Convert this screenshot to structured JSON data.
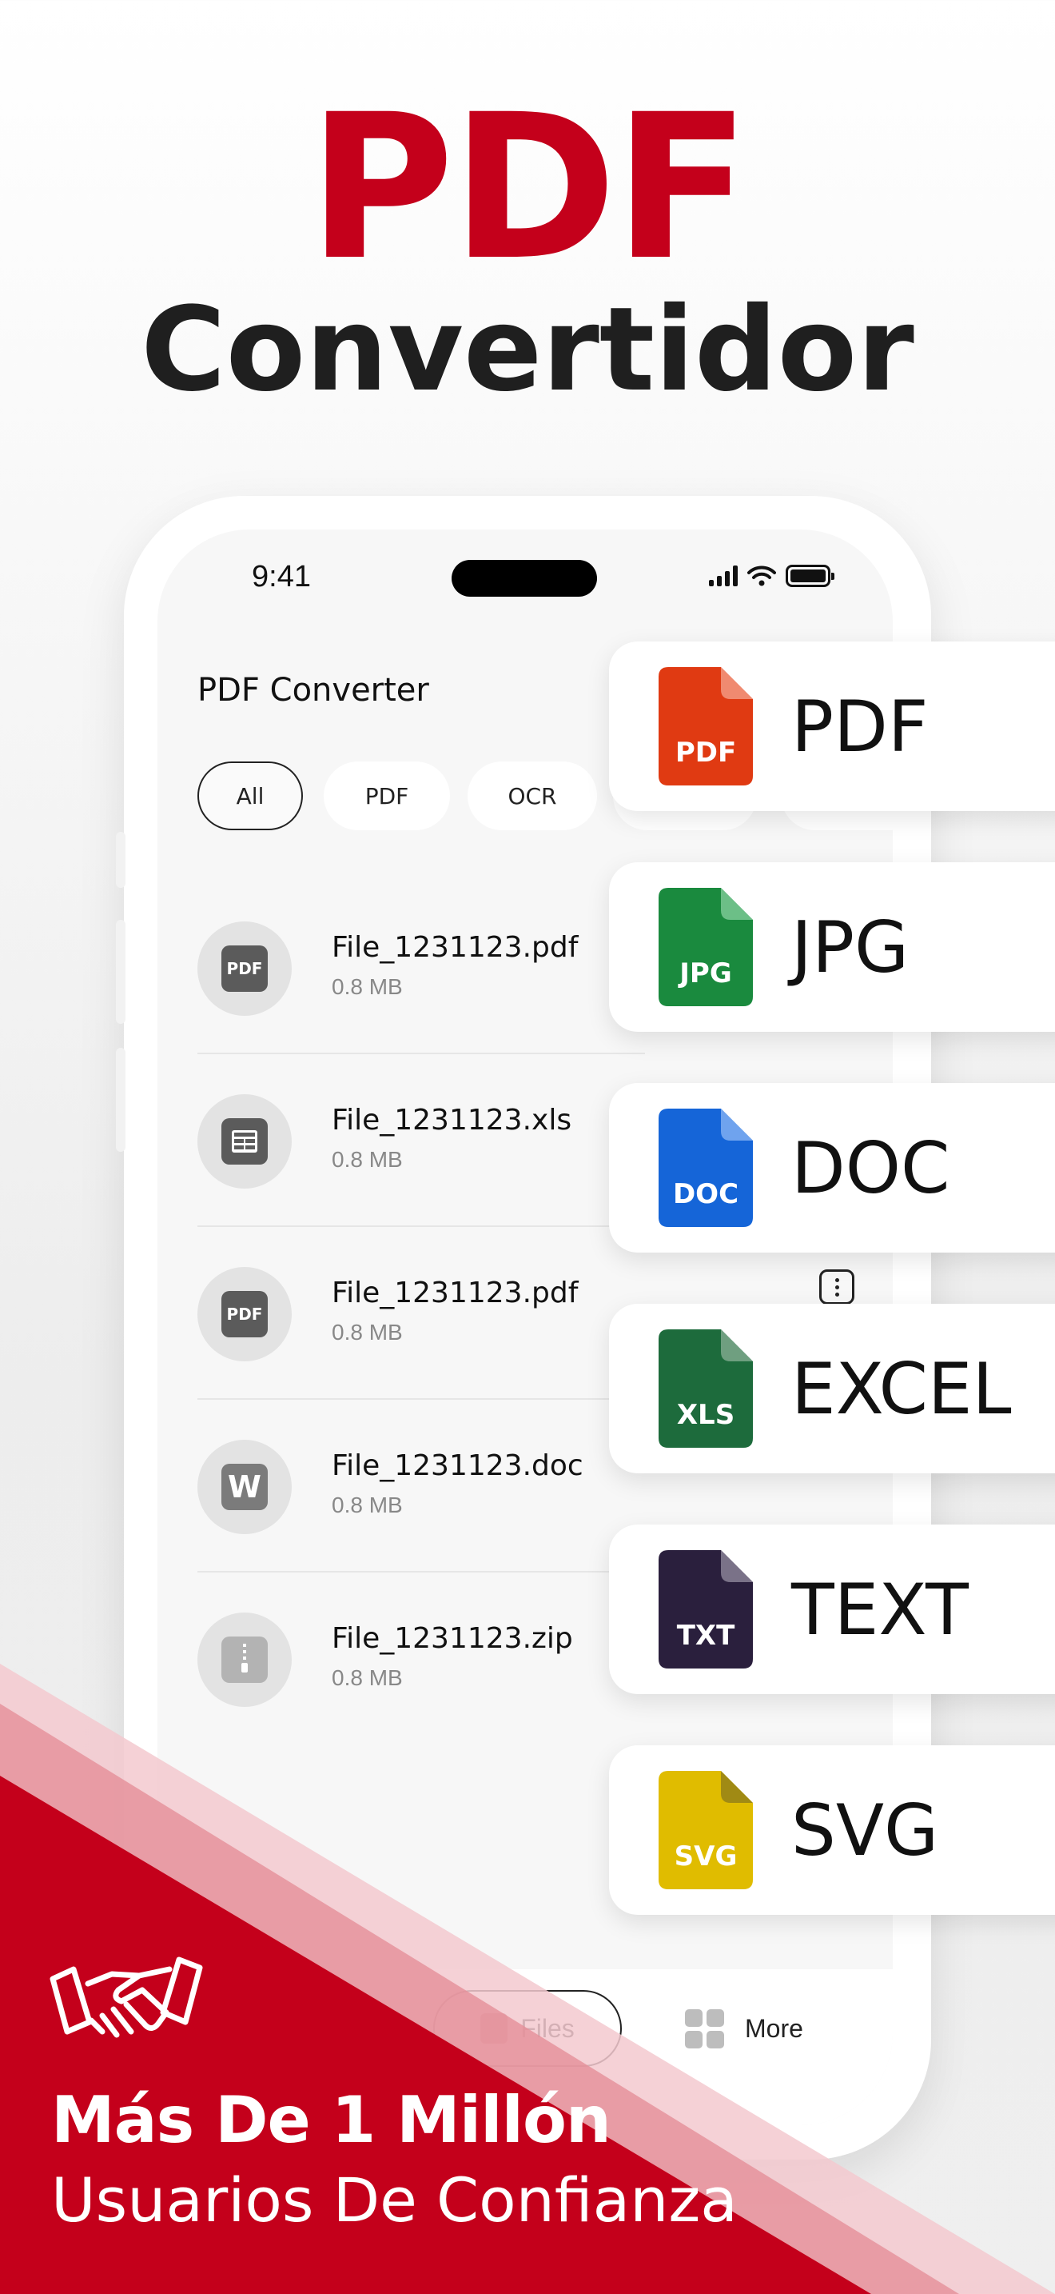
{
  "hero": {
    "title_line1": "PDF",
    "title_line2": "Convertidor"
  },
  "status_bar": {
    "time": "9:41"
  },
  "app": {
    "title": "PDF Converter",
    "filters": [
      "All",
      "PDF",
      "OCR"
    ],
    "files": [
      {
        "name": "File_1231123.pdf",
        "size": "0.8 MB",
        "icon": "pdf-file-icon",
        "icon_text": "PDF"
      },
      {
        "name": "File_1231123.xls",
        "size": "0.8 MB",
        "icon": "spreadsheet-file-icon",
        "icon_text": ""
      },
      {
        "name": "File_1231123.pdf",
        "size": "0.8 MB",
        "icon": "pdf-file-icon",
        "icon_text": "PDF"
      },
      {
        "name": "File_1231123.doc",
        "size": "0.8 MB",
        "icon": "word-file-icon",
        "icon_text": "W"
      },
      {
        "name": "File_1231123.zip",
        "size": "0.8 MB",
        "icon": "zip-file-icon",
        "icon_text": ""
      }
    ],
    "nav": {
      "files_label": "Files",
      "more_label": "More"
    }
  },
  "formats": [
    {
      "label": "PDF",
      "badge": "PDF",
      "color": "#e03a12",
      "fold": "#f08a70"
    },
    {
      "label": "JPG",
      "badge": "JPG",
      "color": "#1a8a3e",
      "fold": "#6cbf87"
    },
    {
      "label": "DOC",
      "badge": "DOC",
      "color": "#1565d8",
      "fold": "#6fa3ee"
    },
    {
      "label": "EXCEL",
      "badge": "XLS",
      "color": "#1d6b3c",
      "fold": "#6f9f80"
    },
    {
      "label": "TEXT",
      "badge": "TXT",
      "color": "#2a1f3d",
      "fold": "#7a7288"
    },
    {
      "label": "SVG",
      "badge": "SVG",
      "color": "#e0bc00",
      "fold": "#a08a14"
    }
  ],
  "promo": {
    "line1": "Más De 1 Millón",
    "line2": "Usuarios De Confianza"
  },
  "colors": {
    "brand_red": "#c4001b",
    "dark_text": "#1f1f1f"
  }
}
